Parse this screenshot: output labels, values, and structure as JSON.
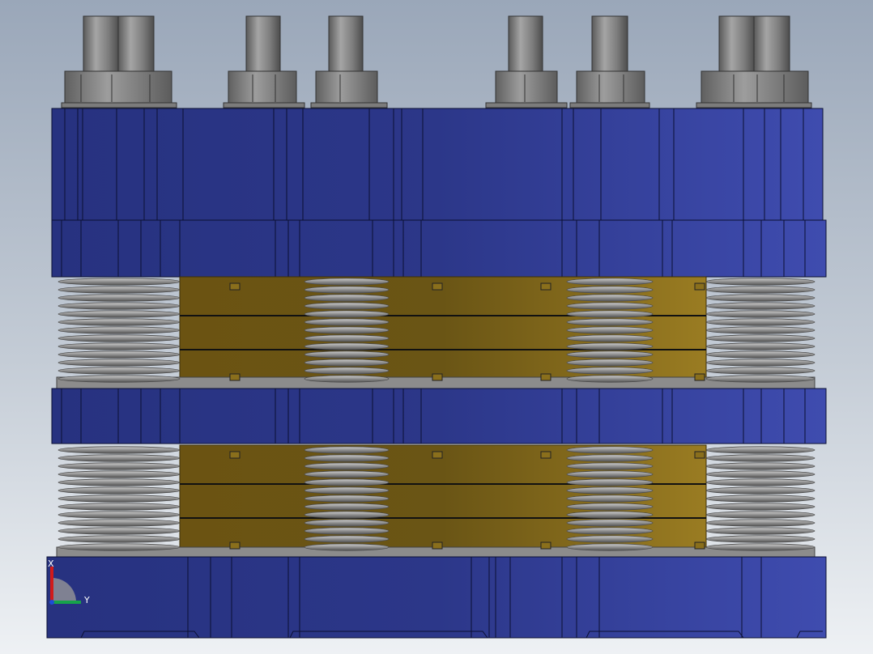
{
  "app": {
    "title": ""
  },
  "model": {
    "description_hidden": "",
    "colors": {
      "plate_blue": "#2f3a8f",
      "plate_blue_light": "#3d4aa8",
      "plate_edge": "#0b1033",
      "brass": "#8a6f1c",
      "brass_dark": "#5f4a12",
      "spring": "#9b9b9b",
      "bolt": "#8c8c8c"
    }
  },
  "triad": {
    "x_label": "X",
    "y_label": "Y",
    "colors": {
      "x": "#d11a1a",
      "y": "#16a34a",
      "z": "#1d4ed8"
    }
  }
}
